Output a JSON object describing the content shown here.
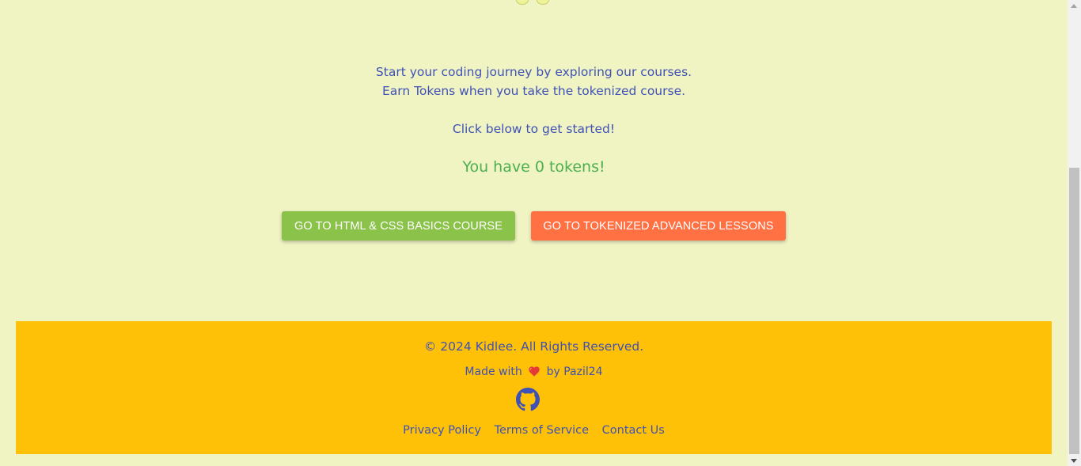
{
  "intro": {
    "line1": "Start your coding journey by exploring our courses.",
    "line2": "Earn Tokens when you take the tokenized course.",
    "line3": "Click below to get started!"
  },
  "tokens_text": "You have 0 tokens!",
  "buttons": {
    "html_course": "GO TO HTML & CSS BASICS COURSE",
    "tokenized": "GO TO TOKENIZED ADVANCED LESSONS"
  },
  "footer": {
    "copyright": "© 2024 Kidlee. All Rights Reserved.",
    "made_prefix": "Made with",
    "made_suffix": "by Pazil24",
    "links": [
      "Privacy Policy",
      "Terms of Service",
      "Contact Us"
    ]
  },
  "colors": {
    "background": "#f0f4c3",
    "text_blue": "#3f51b5",
    "token_green": "#4caf50",
    "button_green": "#8bc34a",
    "button_orange": "#ff7043",
    "footer_yellow": "#ffc107",
    "heart_red": "#e53935"
  },
  "icons": {
    "heart": "heart-icon",
    "github": "github-icon"
  }
}
